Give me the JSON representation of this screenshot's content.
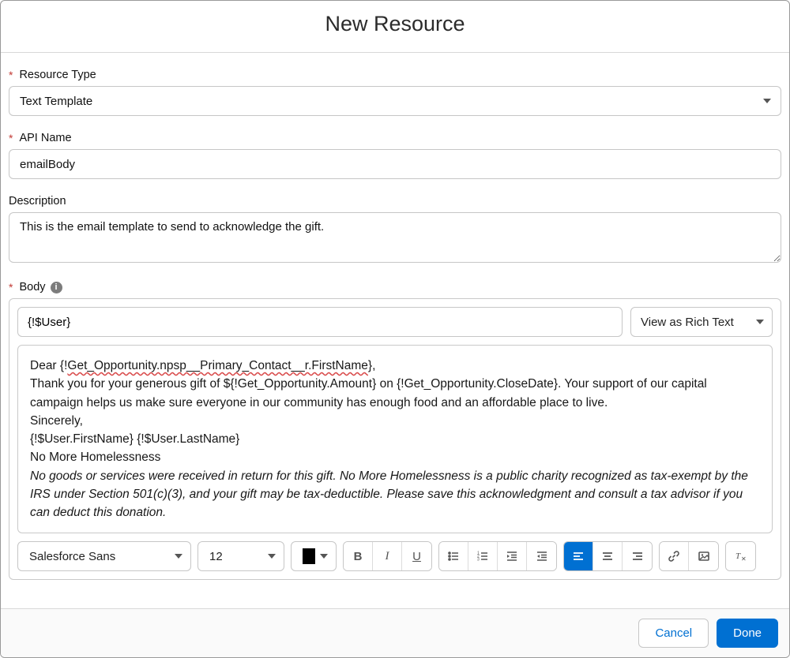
{
  "modal": {
    "title": "New Resource"
  },
  "fields": {
    "resourceType": {
      "label": "Resource Type",
      "value": "Text Template"
    },
    "apiName": {
      "label": "API Name",
      "value": "emailBody"
    },
    "description": {
      "label": "Description",
      "value": "This is the email template to send to acknowledge the gift."
    },
    "body": {
      "label": "Body"
    }
  },
  "bodyEditor": {
    "resourcePicker": "{!$User}",
    "viewAs": "View as Rich Text",
    "line1_prefix": "Dear {!",
    "line1_merge": "Get_Opportunity.npsp__Primary_Contact__r.FirstName",
    "line1_suffix": "},",
    "line2": "Thank you for your generous gift of ${!Get_Opportunity.Amount} on {!Get_Opportunity.CloseDate}. Your support of our capital campaign helps us make sure everyone in our community has enough food and an affordable place to live.",
    "line3": "Sincerely,",
    "line4": "{!$User.FirstName} {!$User.LastName}",
    "line5": "No More Homelessness",
    "disclaimer": "No goods or services were received in return for this gift. No More Homelessness is a public charity recognized as tax-exempt by the IRS under Section 501(c)(3), and your gift may be tax-deductible. Please save this acknowledgment and consult a tax advisor if you can deduct this donation."
  },
  "toolbar": {
    "font": "Salesforce Sans",
    "size": "12",
    "bold": "B",
    "italic": "I",
    "underline": "U"
  },
  "footer": {
    "cancel": "Cancel",
    "done": "Done"
  }
}
